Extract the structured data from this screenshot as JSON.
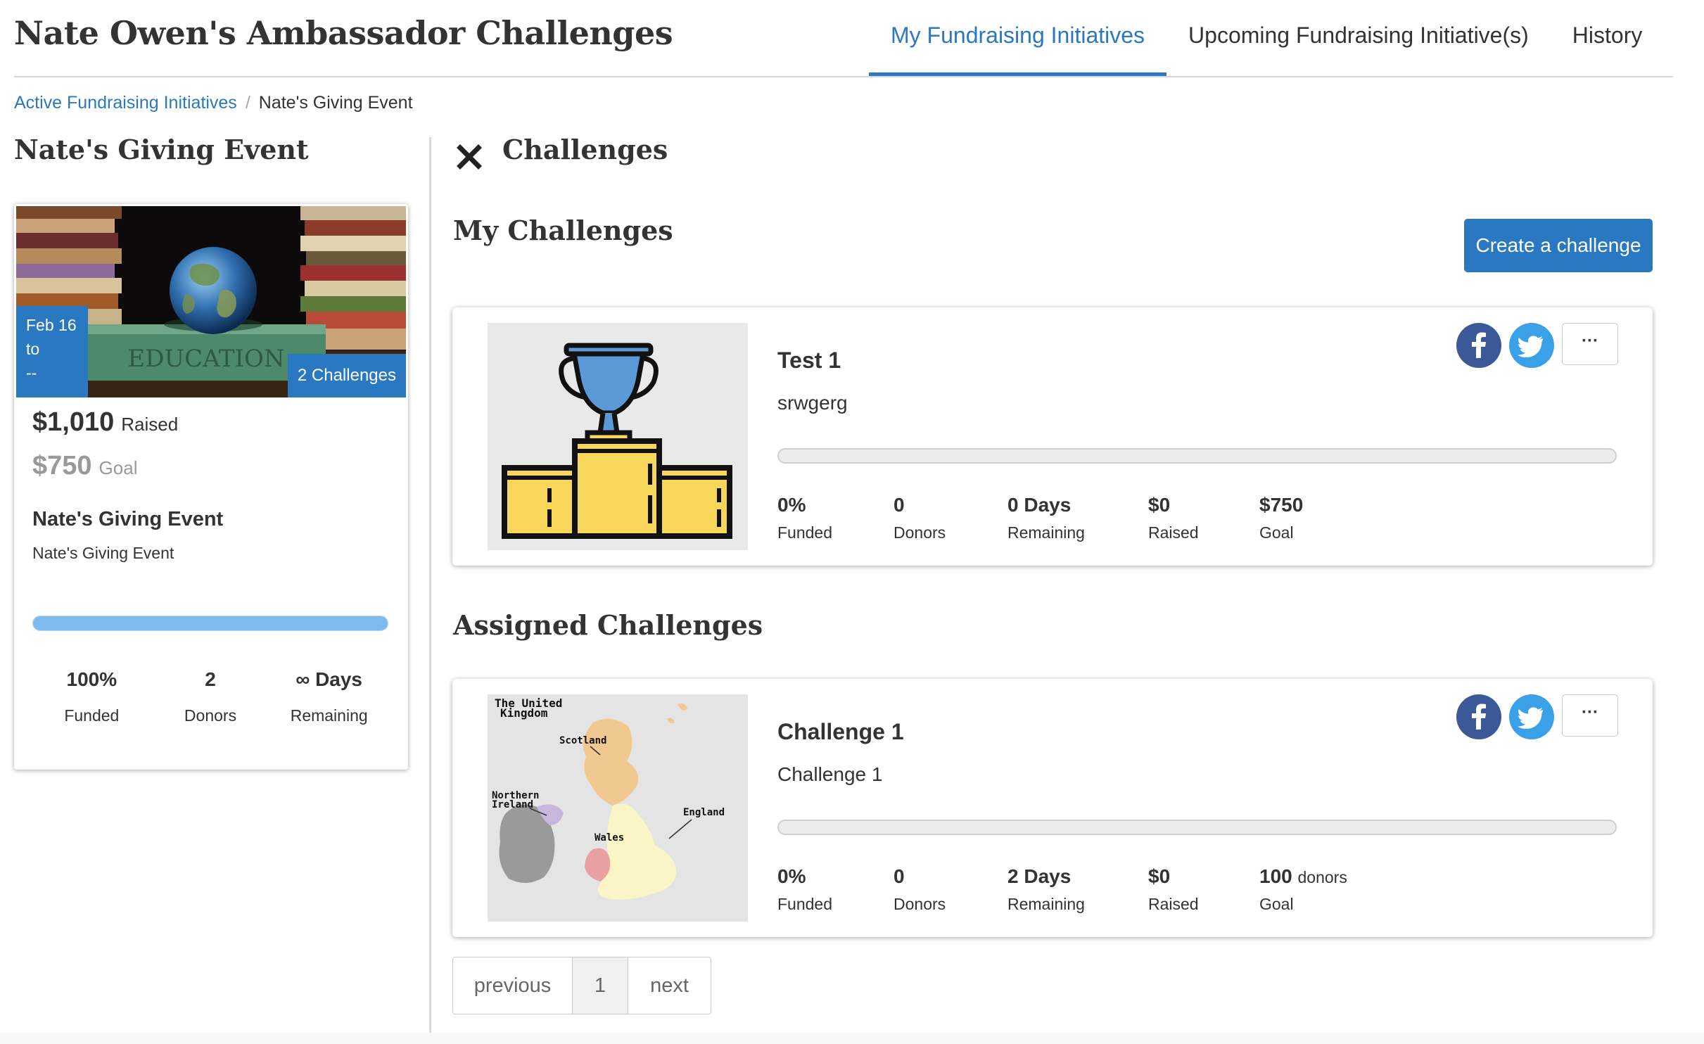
{
  "header": {
    "title": "Nate Owen's Ambassador Challenges",
    "tabs": [
      {
        "label": "My Fundraising Initiatives",
        "active": true
      },
      {
        "label": "Upcoming Fundraising Initiative(s)",
        "active": false
      },
      {
        "label": "History",
        "active": false
      }
    ]
  },
  "breadcrumb": {
    "link": "Active Fundraising Initiatives",
    "separator": "/",
    "current": "Nate's Giving Event"
  },
  "event": {
    "heading": "Nate's Giving Event",
    "date_line1": "Feb 16",
    "date_line2": "to",
    "date_line3": "--",
    "challenges_badge": "2 Challenges",
    "image_texts": {
      "book_label": "EDUCATION"
    },
    "raised_amount": "$1,010",
    "raised_label": "Raised",
    "goal_amount": "$750",
    "goal_label": "Goal",
    "name": "Nate's Giving Event",
    "description": "Nate's Giving Event",
    "progress_fraction": 1.0,
    "stats": [
      {
        "value": "100%",
        "label": "Funded"
      },
      {
        "value": "2",
        "label": "Donors"
      },
      {
        "value": "∞ Days",
        "label": "Remaining"
      }
    ]
  },
  "challenges_panel": {
    "title": "Challenges",
    "my_section_title": "My Challenges",
    "create_button": "Create a challenge",
    "assigned_section_title": "Assigned Challenges"
  },
  "my_challenges": [
    {
      "name": "Test 1",
      "description": "srwgerg",
      "image": "trophy-podium",
      "progress_fraction": 0,
      "more_label": "···",
      "stats": [
        {
          "value": "0%",
          "label": "Funded"
        },
        {
          "value": "0",
          "label": "Donors"
        },
        {
          "value": "0 Days",
          "label": "Remaining"
        },
        {
          "value": "$0",
          "label": "Raised"
        },
        {
          "value": "$750",
          "unit": "",
          "label": "Goal"
        }
      ]
    }
  ],
  "assigned_challenges": [
    {
      "name": "Challenge 1",
      "description": "Challenge 1",
      "image": "uk-map",
      "map_labels": {
        "title_line1": "The United",
        "title_line2": "Kingdom",
        "scotland": "Scotland",
        "ni_line1": "Northern",
        "ni_line2": "Ireland",
        "england": "England",
        "wales": "Wales"
      },
      "progress_fraction": 0,
      "more_label": "···",
      "stats": [
        {
          "value": "0%",
          "label": "Funded"
        },
        {
          "value": "0",
          "label": "Donors"
        },
        {
          "value": "2 Days",
          "label": "Remaining"
        },
        {
          "value": "$0",
          "label": "Raised"
        },
        {
          "value": "100",
          "unit": "donors",
          "label": "Goal"
        }
      ]
    }
  ],
  "pagination": {
    "previous": "previous",
    "page": "1",
    "next": "next"
  },
  "colors": {
    "accent": "#2b78c2",
    "progress_fill": "#7fbaed",
    "facebook": "#3b5998",
    "twitter": "#3aa0e8",
    "trophy_blue": "#5b9ad6",
    "podium_yellow": "#f8d65a"
  },
  "icons": {
    "close": "close-icon",
    "facebook": "facebook-icon",
    "twitter": "twitter-icon",
    "more": "more-icon"
  }
}
